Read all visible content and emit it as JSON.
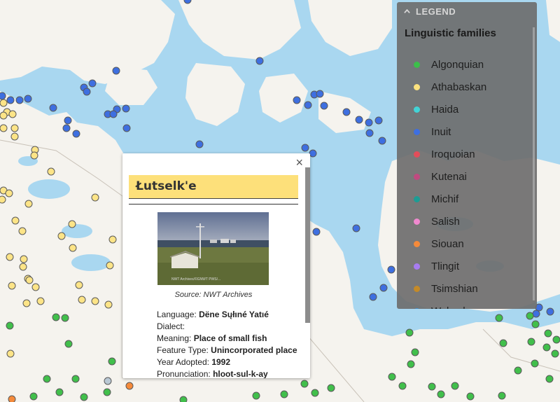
{
  "popup": {
    "close_label": "×",
    "title": "Łutselk'e",
    "photo_watermark": "NWT Archives/©GNWT PWS/...",
    "source": "Source: NWT Archives",
    "fields": [
      {
        "label": "Language:",
        "value": "Dëne Sųłıné Yatıé"
      },
      {
        "label": "Dialect:",
        "value": ""
      },
      {
        "label": "Meaning:",
        "value": "Place of small fish"
      },
      {
        "label": "Feature Type:",
        "value": "Unincorporated place"
      },
      {
        "label": "Year Adopted:",
        "value": "1992"
      },
      {
        "label": "Pronunciation:",
        "value": "hloot-sul-k-ay"
      }
    ]
  },
  "legend": {
    "header": "LEGEND",
    "header_icon": "chevron-up-icon",
    "subtitle": "Linguistic families",
    "items": [
      {
        "label": "Algonquian",
        "color": "#3cbf4a"
      },
      {
        "label": "Athabaskan",
        "color": "#fbe27f"
      },
      {
        "label": "Haida",
        "color": "#42d3d6"
      },
      {
        "label": "Inuit",
        "color": "#3e6fe0"
      },
      {
        "label": "Iroquoian",
        "color": "#e24d5a"
      },
      {
        "label": "Kutenai",
        "color": "#c04a80"
      },
      {
        "label": "Michif",
        "color": "#1d9c94"
      },
      {
        "label": "Salish",
        "color": "#f089cf"
      },
      {
        "label": "Siouan",
        "color": "#f58a3a"
      },
      {
        "label": "Tlingit",
        "color": "#a77cf0"
      },
      {
        "label": "Tsimshian",
        "color": "#c48a28"
      },
      {
        "label": "Wakashan",
        "color": "#3d8fd0"
      }
    ]
  },
  "map": {
    "water_color": "#a9d7f0",
    "land_color": "#f5f3ee",
    "marker_families_visible": [
      "Algonquian",
      "Athabaskan",
      "Inuit",
      "Siouan"
    ]
  }
}
